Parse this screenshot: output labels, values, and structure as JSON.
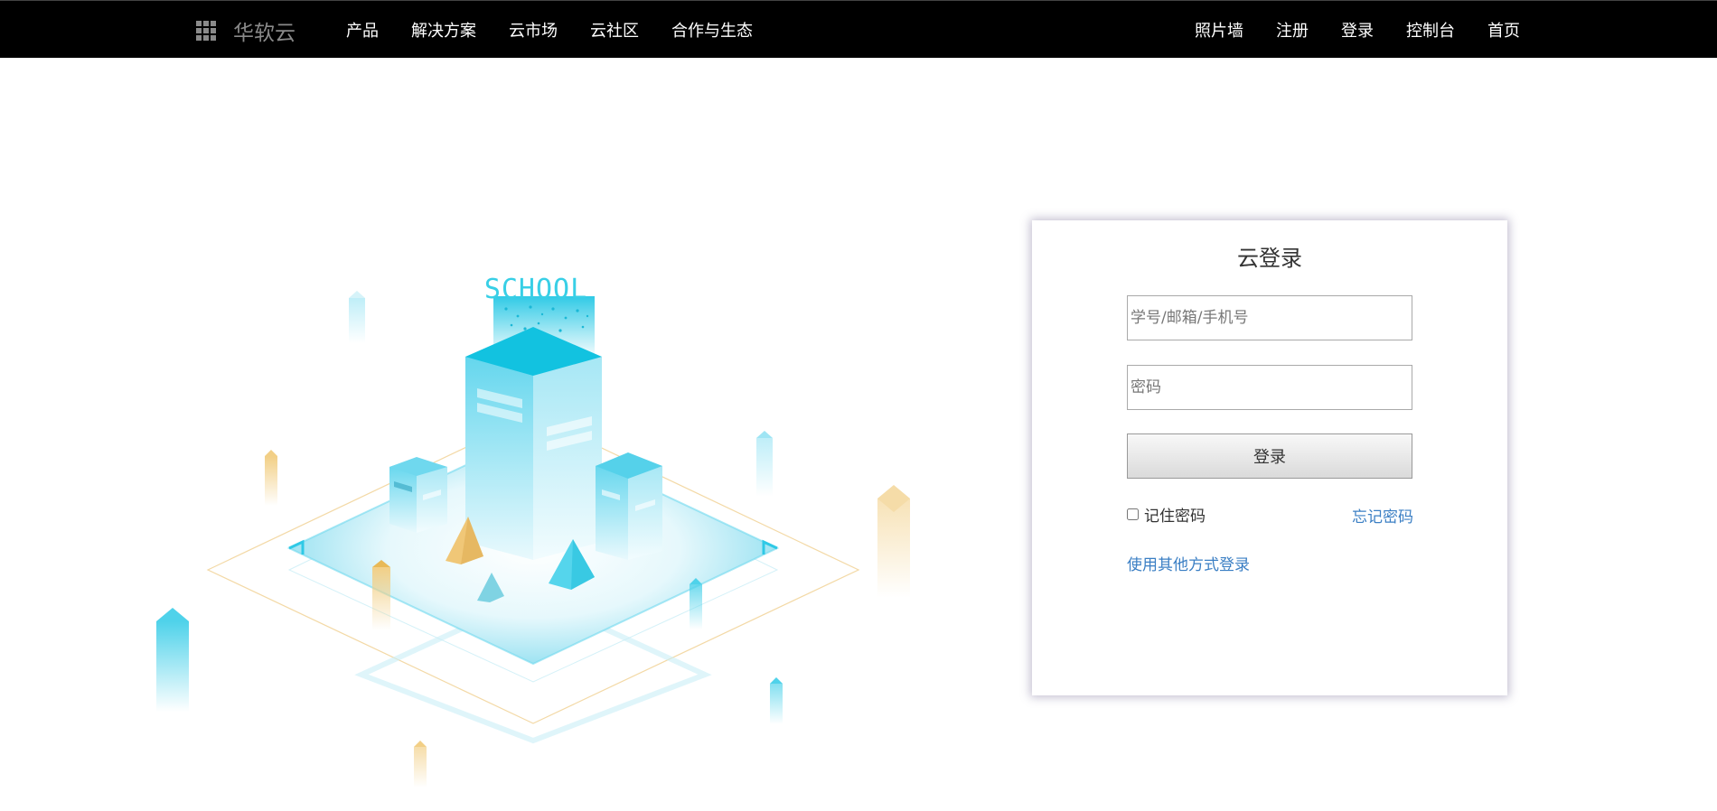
{
  "header": {
    "brand": "华软云",
    "nav_left": [
      "产品",
      "解决方案",
      "云市场",
      "云社区",
      "合作与生态"
    ],
    "nav_right": [
      "照片墙",
      "注册",
      "登录",
      "控制台",
      "首页"
    ]
  },
  "illustration": {
    "sign": "SCHOOL"
  },
  "login": {
    "title": "云登录",
    "username_placeholder": "学号/邮箱/手机号",
    "password_placeholder": "密码",
    "submit_label": "登录",
    "remember_label": "记住密码",
    "forgot_label": "忘记密码",
    "other_login_label": "使用其他方式登录"
  },
  "colors": {
    "topbar": "#000000",
    "accent_link": "#3b7fc4",
    "illustration_cyan": "#4fd2ea",
    "illustration_gold": "#e8b957"
  }
}
